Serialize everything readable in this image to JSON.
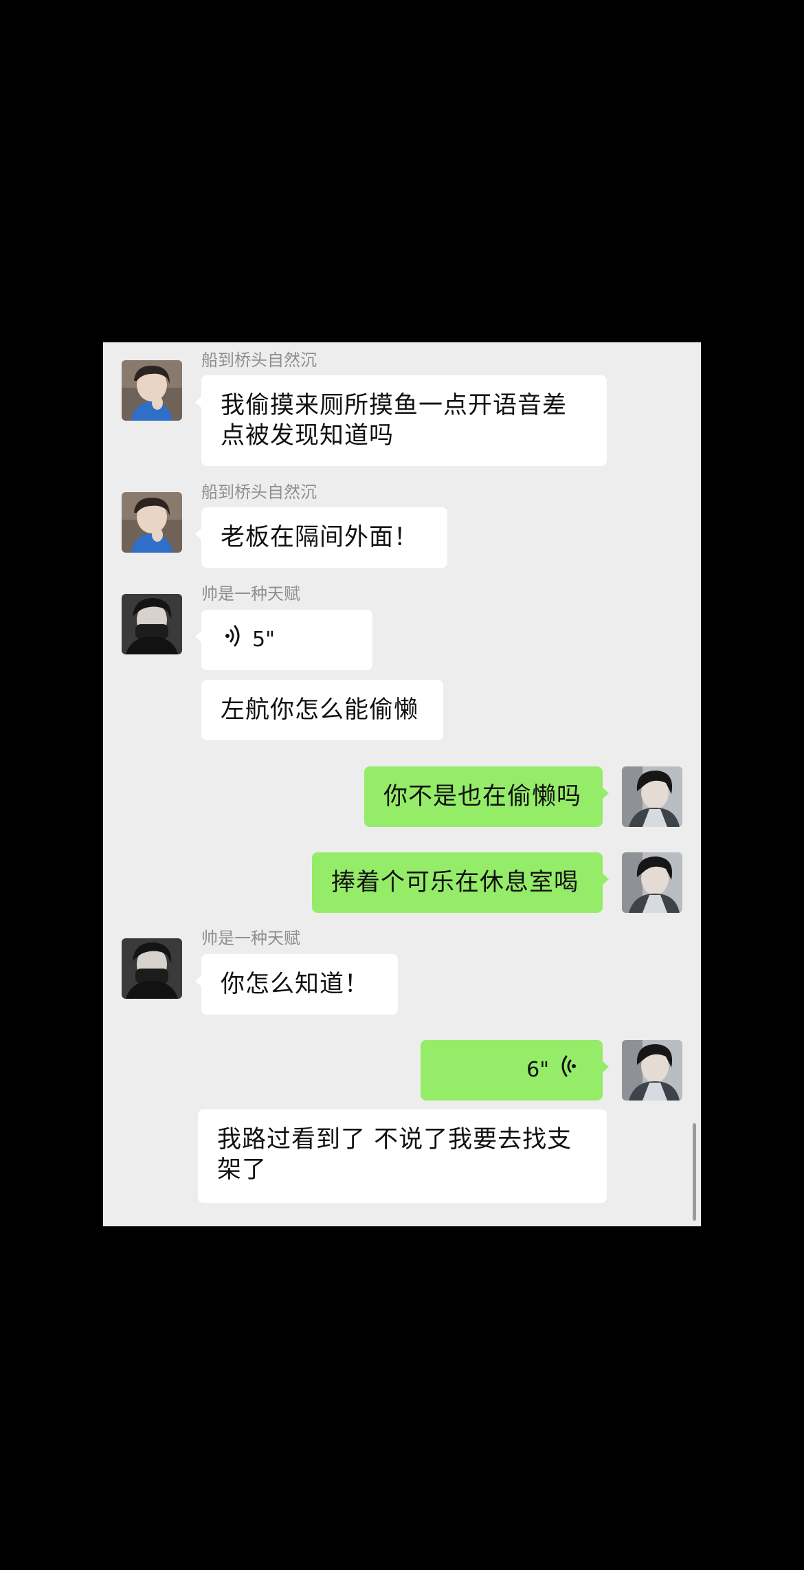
{
  "chat": {
    "messages": [
      {
        "side": "received",
        "sender": "船到桥头自然沉",
        "type": "text",
        "text": "我偷摸来厕所摸鱼一点开语音差点被发现知道吗",
        "lines": [
          "我偷摸来厕所摸鱼一点开语音差",
          "点被发现知道吗"
        ]
      },
      {
        "side": "received",
        "sender": "船到桥头自然沉",
        "type": "text",
        "text": "老板在隔间外面！"
      },
      {
        "side": "received",
        "sender": "帅是一种天赋",
        "type": "voice",
        "duration": "5\""
      },
      {
        "side": "received",
        "type": "text",
        "text": "左航你怎么能偷懒"
      },
      {
        "side": "sent",
        "type": "text",
        "text": "你不是也在偷懒吗"
      },
      {
        "side": "sent",
        "type": "text",
        "text": "捧着个可乐在休息室喝"
      },
      {
        "side": "received",
        "sender": "帅是一种天赋",
        "type": "text",
        "text": "你怎么知道！"
      },
      {
        "side": "sent",
        "type": "voice",
        "duration": "6\""
      },
      {
        "side": "received",
        "type": "text",
        "text": "我路过看到了 不说了我要去找支架了",
        "lines": [
          "我路过看到了 不说了我要去找支",
          "架了"
        ]
      }
    ]
  },
  "colors": {
    "panel_background": "#ededed",
    "received_bubble": "#ffffff",
    "sent_bubble": "#95ec69",
    "sender_name": "#8f8f8f",
    "outer_background": "#000000"
  },
  "icons": {
    "voice_received": "voice-wave-icon",
    "voice_sent": "voice-wave-icon"
  }
}
